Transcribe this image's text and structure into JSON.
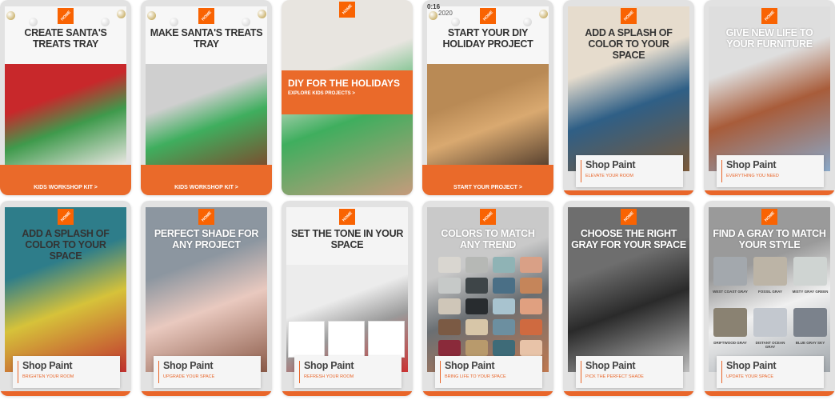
{
  "brand": {
    "logo_text": "THE HOME DEPOT",
    "accent": "#f96302",
    "cta_color": "#ea6a2a"
  },
  "cards": [
    {
      "headline": "CREATE SANTA'S TREATS TRAY",
      "cta": "KIDS WORKSHOP KIT >",
      "style": "cta",
      "image": "santa-tray",
      "colors": [
        "#c8282b",
        "#3f9a4c",
        "#e9e6e2"
      ]
    },
    {
      "headline": "MAKE SANTA'S TREATS TRAY",
      "cta": "KIDS WORKSHOP KIT >",
      "style": "cta",
      "image": "boy-holding-tray",
      "colors": [
        "#cfcfcf",
        "#3fae5e",
        "#7a5030"
      ]
    },
    {
      "headline": "",
      "band_title": "DIY FOR THE HOLIDAYS",
      "band_sub": "EXPLORE KIDS PROJECTS >",
      "style": "band",
      "image": "kids-projects",
      "colors": [
        "#e8e5e0",
        "#3fae5e",
        "#c59b7c"
      ]
    },
    {
      "headline": "START YOUR DIY HOLIDAY PROJECT",
      "cta": "START YOUR PROJECT >",
      "style": "cta",
      "timer": "0:16",
      "year": "2020",
      "image": "wood-burning",
      "colors": [
        "#b98a55",
        "#d9a970",
        "#5a4330"
      ]
    },
    {
      "headline": "ADD A SPLASH OF COLOR TO YOUR SPACE",
      "shop_title": "Shop Paint",
      "shop_sub": "ELEVATE YOUR ROOM",
      "style": "shop",
      "image": "blue-cabinet",
      "colors": [
        "#e6dccd",
        "#2f5f86",
        "#7b5a3a"
      ]
    },
    {
      "headline": "GIVE NEW LIFE TO YOUR FURNITURE",
      "shop_title": "Shop Paint",
      "shop_sub": "EVERYTHING YOU NEED",
      "style": "shop",
      "light": true,
      "image": "furniture-spraying",
      "colors": [
        "#dedede",
        "#a85c3a",
        "#8aa8c8"
      ]
    },
    {
      "headline": "ADD A SPLASH OF COLOR TO YOUR SPACE",
      "shop_title": "Shop Paint",
      "shop_sub": "BRIGHTEN YOUR ROOM",
      "style": "shop",
      "image": "teal-wall-room",
      "colors": [
        "#2e7d8a",
        "#d6c23a",
        "#c0312f"
      ]
    },
    {
      "headline": "PERFECT SHADE FOR ANY PROJECT",
      "shop_title": "Shop Paint",
      "shop_sub": "UPGRADE YOUR SPACE",
      "style": "shop",
      "light": true,
      "image": "gray-siding-porch",
      "colors": [
        "#8c96a0",
        "#e9c9bf",
        "#8a5a48"
      ]
    },
    {
      "headline": "SET THE TONE IN YOUR SPACE",
      "shop_title": "Shop Paint",
      "shop_sub": "REFRESH YOUR ROOM",
      "style": "shop",
      "image": "living-room-supplies",
      "colors": [
        "#ececec",
        "#9a9a9a",
        "#cc3333"
      ]
    },
    {
      "headline": "COLORS TO MATCH ANY TREND",
      "shop_title": "Shop Paint",
      "shop_sub": "BRING LIFE TO YOUR SPACE",
      "style": "shop",
      "light": true,
      "image": "paint-swatches",
      "colors": [
        "#c9c9c9",
        "#6a6f73",
        "#c07850"
      ]
    },
    {
      "headline": "CHOOSE THE RIGHT GRAY FOR YOUR SPACE",
      "shop_title": "Shop Paint",
      "shop_sub": "PICK THE PERFECT SHADE",
      "style": "shop",
      "light": true,
      "image": "gray-fan-deck",
      "colors": [
        "#6e6e6e",
        "#2a2a2a",
        "#bdbdbd"
      ]
    },
    {
      "headline": "FIND A GRAY TO MATCH YOUR STYLE",
      "shop_title": "Shop Paint",
      "shop_sub": "UPDATE YOUR SPACE",
      "style": "shop",
      "light": true,
      "image": "gray-swatches",
      "colors": [
        "#9a9a9a",
        "#f0f0f0",
        "#a0a6ab"
      ],
      "swatches": [
        {
          "name": "WEST COAST GRAY",
          "color": "#a3a8ad"
        },
        {
          "name": "FOSSIL GRAY",
          "color": "#bcb4a6"
        },
        {
          "name": "MISTY GRAY GREEN",
          "color": "#cfd4d2"
        },
        {
          "name": "DRIFTWOOD GRAY",
          "color": "#8a8272"
        },
        {
          "name": "DISTANT OCEAN GRAY",
          "color": "#c3c8cf"
        },
        {
          "name": "BLUE GRAY SKY",
          "color": "#7b828c"
        }
      ]
    }
  ]
}
